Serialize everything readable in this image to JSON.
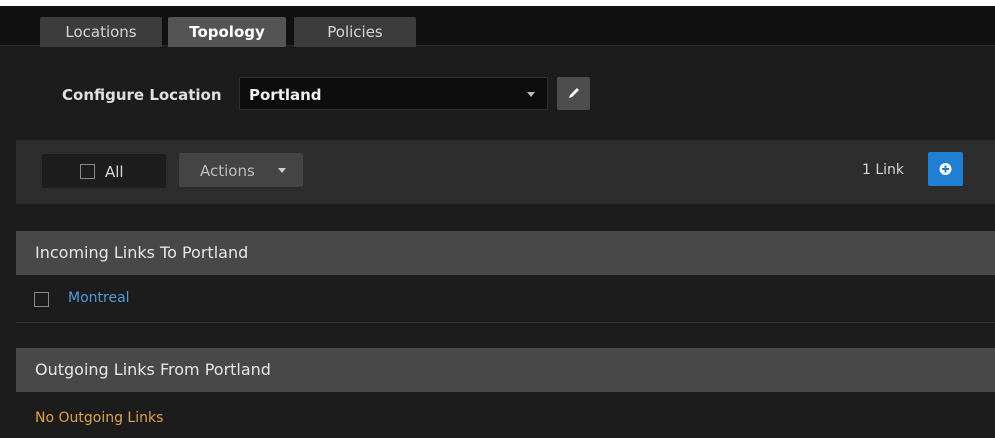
{
  "tabs": [
    {
      "label": "Locations",
      "active": false
    },
    {
      "label": "Topology",
      "active": true
    },
    {
      "label": "Policies",
      "active": false
    }
  ],
  "config": {
    "label": "Configure Location",
    "selected": "Portland",
    "edit_icon": "pencil-icon"
  },
  "actionbar": {
    "all_label": "All",
    "actions_label": "Actions",
    "count_label": "1 Link",
    "add_icon": "plus-circle-icon"
  },
  "incoming": {
    "header": "Incoming Links To Portland",
    "items": [
      {
        "label": "Montreal",
        "checked": false
      }
    ]
  },
  "outgoing": {
    "header": "Outgoing Links From Portland",
    "empty": "No Outgoing Links"
  },
  "colors": {
    "accent": "#1f7fd3",
    "link": "#4f9bdc",
    "warning": "#e0a24a",
    "background": "#1c1c1c"
  }
}
